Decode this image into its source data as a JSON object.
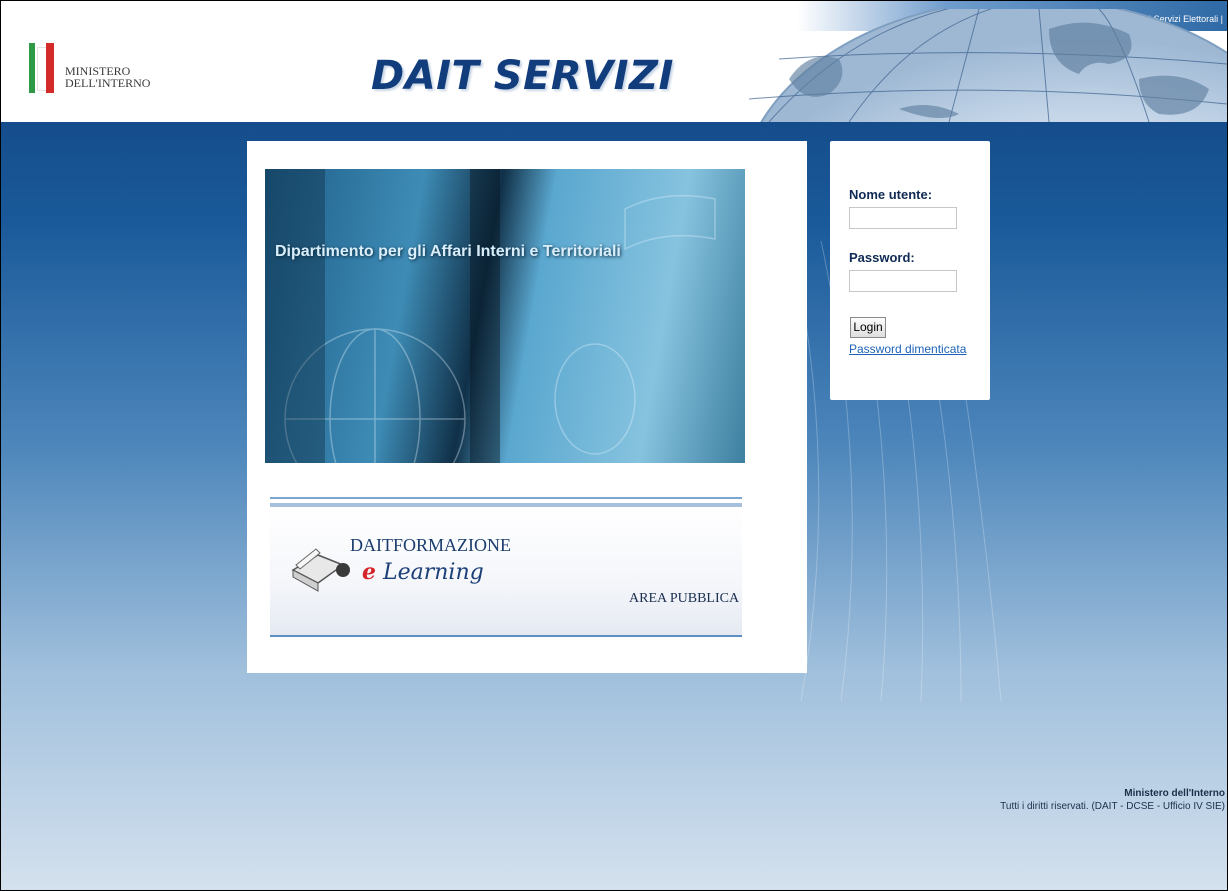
{
  "header": {
    "top_links": "Dipartimento per gli Affari Interni e Territoriali | Servizi Elettorali |",
    "logo_line1": "MINISTERO",
    "logo_line2": "DELL'INTERNO",
    "brand": "DAIT SERVIZI"
  },
  "hero": {
    "title": "Dipartimento per gli Affari Interni e Territoriali"
  },
  "elearning": {
    "title": "DAITFORMAZIONE",
    "subtitle_e": "e",
    "subtitle_rest": "Learning",
    "area": "AREA PUBBLICA"
  },
  "login": {
    "username_label": "Nome utente:",
    "username_value": "",
    "password_label": "Password:",
    "password_value": "",
    "login_button": "Login",
    "forgot_link": "Password dimenticata"
  },
  "footer": {
    "title": "Ministero dell'Interno",
    "copyright": "Tutti i diritti riservati. (DAIT - DCSE - Ufficio IV SIE)"
  }
}
